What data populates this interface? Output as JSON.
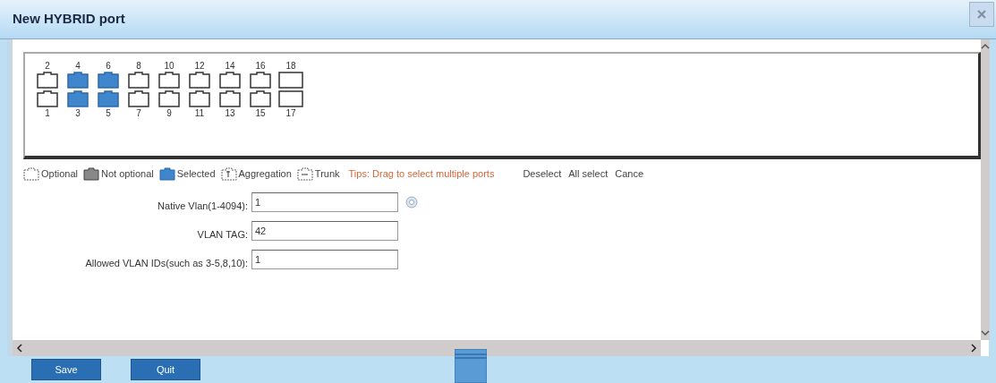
{
  "window": {
    "title": "New HYBRID port"
  },
  "ports_top": [
    {
      "label": "2",
      "kind": "rj45",
      "selected": false
    },
    {
      "label": "4",
      "kind": "rj45",
      "selected": true
    },
    {
      "label": "6",
      "kind": "rj45",
      "selected": true
    },
    {
      "label": "8",
      "kind": "rj45",
      "selected": false
    },
    {
      "label": "10",
      "kind": "rj45",
      "selected": false
    },
    {
      "label": "12",
      "kind": "rj45",
      "selected": false
    },
    {
      "label": "14",
      "kind": "rj45",
      "selected": false
    },
    {
      "label": "16",
      "kind": "rj45",
      "selected": false
    },
    {
      "label": "18",
      "kind": "sfp",
      "selected": false
    }
  ],
  "ports_bottom": [
    {
      "label": "1",
      "kind": "rj45",
      "selected": false
    },
    {
      "label": "3",
      "kind": "rj45",
      "selected": true
    },
    {
      "label": "5",
      "kind": "rj45",
      "selected": true
    },
    {
      "label": "7",
      "kind": "rj45",
      "selected": false
    },
    {
      "label": "9",
      "kind": "rj45",
      "selected": false
    },
    {
      "label": "11",
      "kind": "rj45",
      "selected": false
    },
    {
      "label": "13",
      "kind": "rj45",
      "selected": false
    },
    {
      "label": "15",
      "kind": "rj45",
      "selected": false
    },
    {
      "label": "17",
      "kind": "sfp",
      "selected": false
    }
  ],
  "legend": [
    {
      "kind": "optional",
      "label": "Optional"
    },
    {
      "kind": "not_optional",
      "label": "Not optional"
    },
    {
      "kind": "selected",
      "label": "Selected"
    },
    {
      "kind": "aggregation",
      "label": "Aggregation"
    },
    {
      "kind": "trunk",
      "label": "Trunk"
    }
  ],
  "tip": "Tips: Drag to select multiple ports",
  "actions": [
    "Deselect",
    "All select",
    "Cance"
  ],
  "form": [
    {
      "label": "Native Vlan(1-4094):",
      "value": "1",
      "help": true
    },
    {
      "label": "VLAN TAG:",
      "value": "42",
      "help": false
    },
    {
      "label": "Allowed VLAN IDs(such as 3-5,8,10):",
      "value": "1",
      "help": false
    }
  ],
  "buttons": [
    "Save",
    "Quit"
  ]
}
